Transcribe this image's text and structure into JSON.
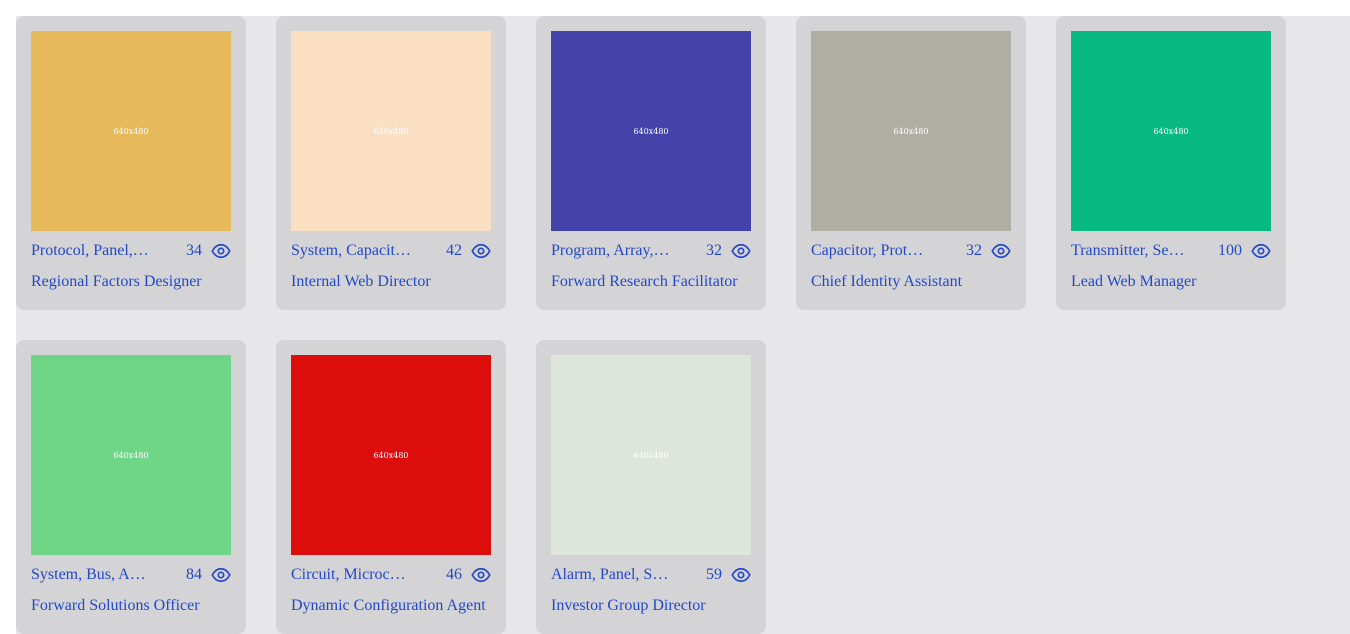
{
  "cards": [
    {
      "image_label": "640x480",
      "image_color": "#e6ba5b",
      "tags": "Protocol, Panel, Microchip",
      "views": "34",
      "title": "Regional Factors Designer"
    },
    {
      "image_label": "640x480",
      "image_color": "#fadfc3",
      "tags": "System, Capacitor, Bus",
      "views": "42",
      "title": "Internal Web Director"
    },
    {
      "image_label": "640x480",
      "image_color": "#4343aa",
      "tags": "Program, Array, Circuit",
      "views": "32",
      "title": "Forward Research Facilitator"
    },
    {
      "image_label": "640x480",
      "image_color": "#b0aea2",
      "tags": "Capacitor, Protocol, Panel",
      "views": "32",
      "title": "Chief Identity Assistant"
    },
    {
      "image_label": "640x480",
      "image_color": "#08b881",
      "tags": "Transmitter, Sensor, Bus",
      "views": "100",
      "title": "Lead Web Manager"
    },
    {
      "image_label": "640x480",
      "image_color": "#6fd687",
      "tags": "System, Bus, Array",
      "views": "84",
      "title": "Forward Solutions Officer"
    },
    {
      "image_label": "640x480",
      "image_color": "#de0d0d",
      "tags": "Circuit, Microchip, Panel",
      "views": "46",
      "title": "Dynamic Configuration Agent"
    },
    {
      "image_label": "640x480",
      "image_color": "#dee5db",
      "tags": "Alarm, Panel, System",
      "views": "59",
      "title": "Investor Group Director"
    }
  ],
  "icons": {
    "views": "eye-icon"
  },
  "colors": {
    "background": "#e7e7e9",
    "card": "#d4d4d7",
    "link": "#2348c7"
  }
}
